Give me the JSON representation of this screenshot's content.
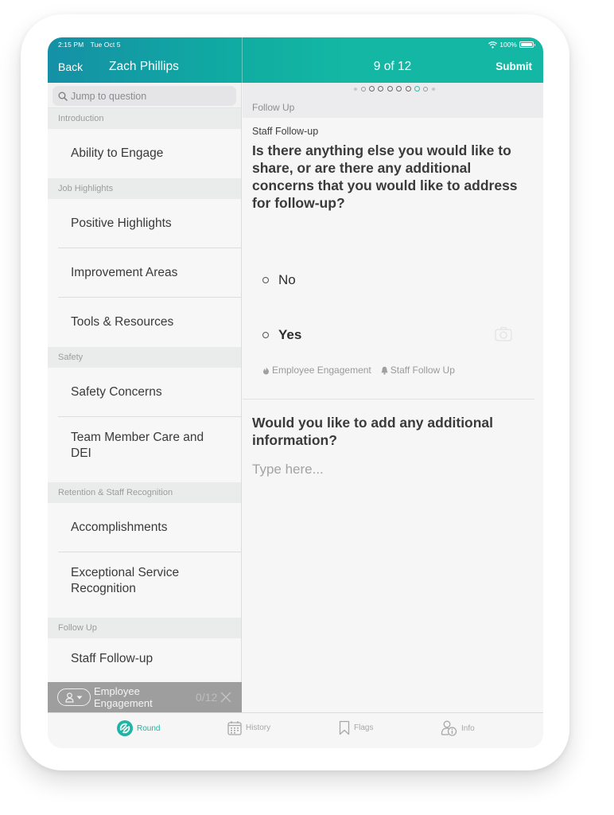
{
  "status_bar": {
    "time": "2:15 PM",
    "date": "Tue Oct 5",
    "battery": "100%"
  },
  "header": {
    "back_label": "Back",
    "person_name": "Zach Phillips",
    "progress_label": "9 of 12",
    "submit_label": "Submit"
  },
  "colors": {
    "accent": "#13b7a3",
    "accent_dark": "#1590a6",
    "active_dot": "#26c0b3"
  },
  "sidebar": {
    "search_placeholder": "Jump to question",
    "sections": [
      {
        "title": "Introduction",
        "items": [
          "Ability to Engage"
        ]
      },
      {
        "title": "Job Highlights",
        "items": [
          "Positive Highlights",
          "Improvement Areas",
          "Tools & Resources"
        ]
      },
      {
        "title": "Safety",
        "items": [
          "Safety Concerns",
          "Team Member Care and DEI"
        ]
      },
      {
        "title": "Retention & Staff Recognition",
        "items": [
          "Accomplishments",
          "Exceptional Service Recognition"
        ]
      },
      {
        "title": "Follow Up",
        "items": [
          "Staff Follow-up"
        ]
      }
    ],
    "tag_bar": {
      "name": "Employee Engagement",
      "count": "0/12"
    }
  },
  "pager": {
    "total_dots": 10,
    "current_index": 7
  },
  "main": {
    "section_label": "Follow Up",
    "question1": {
      "subtitle": "Staff Follow-up",
      "text": "Is there anything else you would like to share, or are there any additional concerns that you would like to address for follow-up?",
      "options": [
        {
          "label": "No",
          "selected": false
        },
        {
          "label": "Yes",
          "selected": false
        }
      ],
      "tags": [
        "Employee Engagement",
        "Staff Follow Up"
      ]
    },
    "question2": {
      "text": "Would you like to add any additional information?",
      "placeholder": "Type here...",
      "value": ""
    }
  },
  "tabbar": {
    "tabs": [
      {
        "label": "Round",
        "icon": "round-icon",
        "active": true
      },
      {
        "label": "History",
        "icon": "calendar-icon",
        "active": false
      },
      {
        "label": "Flags",
        "icon": "bookmark-icon",
        "active": false
      },
      {
        "label": "Info",
        "icon": "person-info-icon",
        "active": false
      }
    ]
  }
}
